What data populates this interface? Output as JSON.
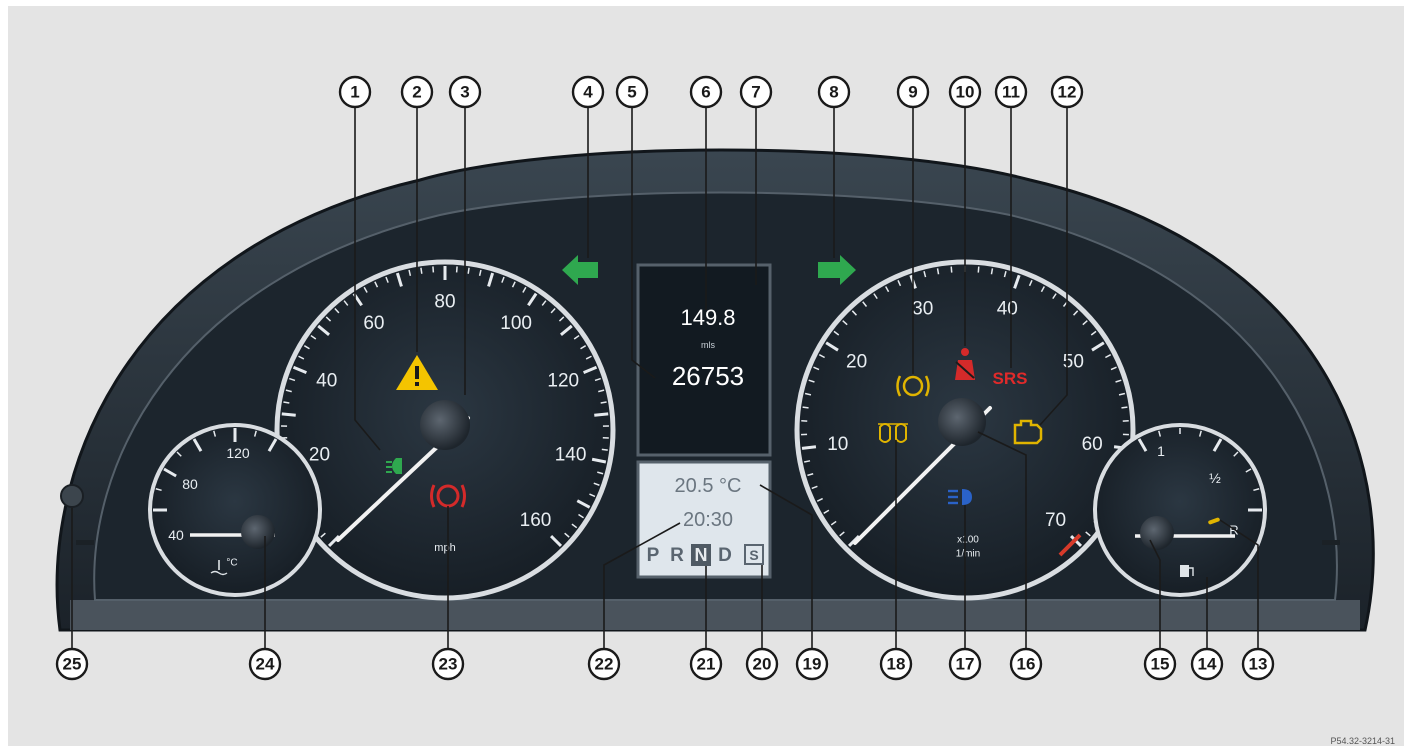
{
  "speedometer": {
    "labels": [
      "20",
      "40",
      "60",
      "80",
      "100",
      "120",
      "140",
      "160"
    ],
    "unit": "mph"
  },
  "tachometer": {
    "labels": [
      "10",
      "20",
      "30",
      "40",
      "50",
      "60",
      "70"
    ],
    "unit_line1": "x100",
    "unit_line2": "1/min"
  },
  "coolant_gauge": {
    "labels": [
      "40",
      "80",
      "120"
    ],
    "unit": "°C"
  },
  "fuel_gauge": {
    "labels": [
      "1",
      "½",
      "R"
    ]
  },
  "display": {
    "trip": "149.8",
    "trip_unit": "mls",
    "odometer": "26753",
    "outside_temp": "20.5 °C",
    "clock": "20:30",
    "gears": [
      "P",
      "R",
      "N",
      "D"
    ],
    "active_gear": "N",
    "program": "S"
  },
  "warning_lamps": {
    "srs": "SRS"
  },
  "callouts": [
    "1",
    "2",
    "3",
    "4",
    "5",
    "6",
    "7",
    "8",
    "9",
    "10",
    "11",
    "12",
    "13",
    "14",
    "15",
    "16",
    "17",
    "18",
    "19",
    "20",
    "21",
    "22",
    "23",
    "24",
    "25"
  ],
  "figure_ref": "P54.32-3214-31",
  "colors": {
    "turn_signal": "#2fa84f",
    "warning": "#f4c400",
    "brake": "#d42a2a",
    "srs": "#e02a2a",
    "low_beam": "#2a62c8",
    "amber": "#e0b400"
  }
}
